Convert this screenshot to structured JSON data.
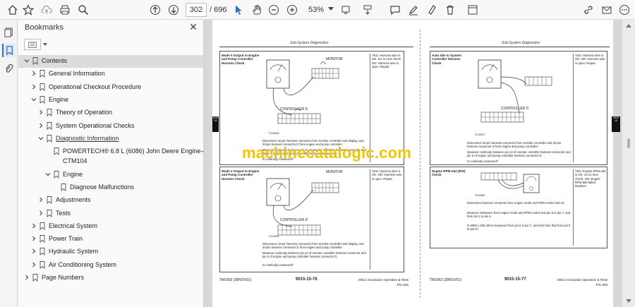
{
  "toolbar": {
    "page_current": "302",
    "page_total": "/ 696",
    "zoom": "53%"
  },
  "panel": {
    "title": "Bookmarks",
    "close": "✕"
  },
  "bookmarks": [
    {
      "label": "Contents",
      "level": 0,
      "chev": "down",
      "selected": true
    },
    {
      "label": "General Information",
      "level": 1,
      "chev": "right"
    },
    {
      "label": "Operational Checkout Procedure",
      "level": 1,
      "chev": "right"
    },
    {
      "label": "Engine",
      "level": 1,
      "chev": "down"
    },
    {
      "label": "Theory of Operation",
      "level": 2,
      "chev": "right"
    },
    {
      "label": "System Operational Checks",
      "level": 2,
      "chev": "right"
    },
    {
      "label": "Diagnostic Information",
      "level": 2,
      "chev": "down",
      "link": true
    },
    {
      "label": "POWERTECH® 6.8 L (6086) John Deere Engine—Use",
      "level": 3,
      "chev": "none",
      "extra": "CTM104"
    },
    {
      "label": "Engine",
      "level": 3,
      "chev": "down"
    },
    {
      "label": "Diagnose Malfunctions",
      "level": 4,
      "chev": "none"
    },
    {
      "label": "Adjustments",
      "level": 2,
      "chev": "right"
    },
    {
      "label": "Tests",
      "level": 2,
      "chev": "right"
    },
    {
      "label": "Electrical System",
      "level": 1,
      "chev": "right"
    },
    {
      "label": "Power Train",
      "level": 1,
      "chev": "right"
    },
    {
      "label": "Hydraulic System",
      "level": 1,
      "chev": "right"
    },
    {
      "label": "Air Conditioning System",
      "level": 1,
      "chev": "right"
    },
    {
      "label": "Page Numbers",
      "level": 0,
      "chev": "right"
    }
  ],
  "doc": {
    "left": {
      "header": "Sub-System Diagnostics",
      "sec1": {
        "title": "Mode 0 Output to Engine and Pump Controller Harness Check",
        "side": "YES: Harness wire is OK. Go to next check. NO: Harness wire is open. Repair.",
        "monitor": "MONITOR",
        "controller": "CONTROLLER D",
        "fig": "T118098",
        "body1": "Disconnect 16-pin harness connector from monitor controller and display, and 20-pin harness connector D from engine and pump controller.",
        "body2": "Measure continuity between pin 21 of monitor controller harness connector and pin 3 of engine and pump controller harness connector D.",
        "body3": "Is continuity measured?"
      },
      "sec2": {
        "title": "Mode 2 Output to Engine and Pump Controller Harness Check",
        "side": "YES: Harness wire is OK. NO: Harness wire is open. Repair.",
        "monitor": "MONITOR",
        "controller": "CONTROLLER D",
        "fig": "T118096",
        "body1": "Disconnect 16-pin harness connector from monitor controller and display, and 20-pin harness connector D from engine and pump controller.",
        "body2": "Measure continuity between pin 22 of monitor controller harness connector and pin 4 of engine and pump controller harness connector D.",
        "body3": "Is continuity measured?"
      },
      "footer_l": "TM1663 (28NOV01)",
      "footer_c": "9015-15-76",
      "footer_r": "200LC Excavator Operation & Tests",
      "footer_r2": "PN=302"
    },
    "right": {
      "header": "Sub-System Diagnostics",
      "sec1": {
        "title": "Auto Idle to System Controller Harness Check",
        "side": "YES: Harness wire is OK. NO: Harness wire is open. Repair.",
        "controller": "CONTROLLER D",
        "fig": "T118097",
        "body1": "Disconnect 16-pin harness connector from monitor controller and 20-pin harness connector D from engine and pump controller.",
        "body2": "Measure continuity between pin 13 of monitor controller harness connector and pin 6 of engine and pump controller harness connector D.",
        "body3": "Is continuity measured?"
      },
      "sec2": {
        "title": "Engine RPM Dial (R/S) Check",
        "side": "YES: Engine RPM dial is OK. Go to next check. NO: Engine RPM dial failed. Replace.",
        "fig": "T118380",
        "body1": "Disconnect harness connector from engine mode and RPM control unit A4.",
        "body2": "Measure resistance from engine mode and RPM control unit pin 5 to pin 7, and from pin 5 to pin 6.",
        "body3": "Is 5000 ± 500 ohms measured from pin 5 to pin 7, and less than that from pin 5 to pin 6?"
      },
      "footer_l": "TM1663 (28NOV01)",
      "footer_c": "9015-15-77",
      "footer_r": "200LC Excavator Operation & Tests",
      "footer_r2": "PN=303"
    },
    "tab_left": "9015 15",
    "tab_right": "9015 15",
    "watermark": "machinecatalogic.com"
  }
}
